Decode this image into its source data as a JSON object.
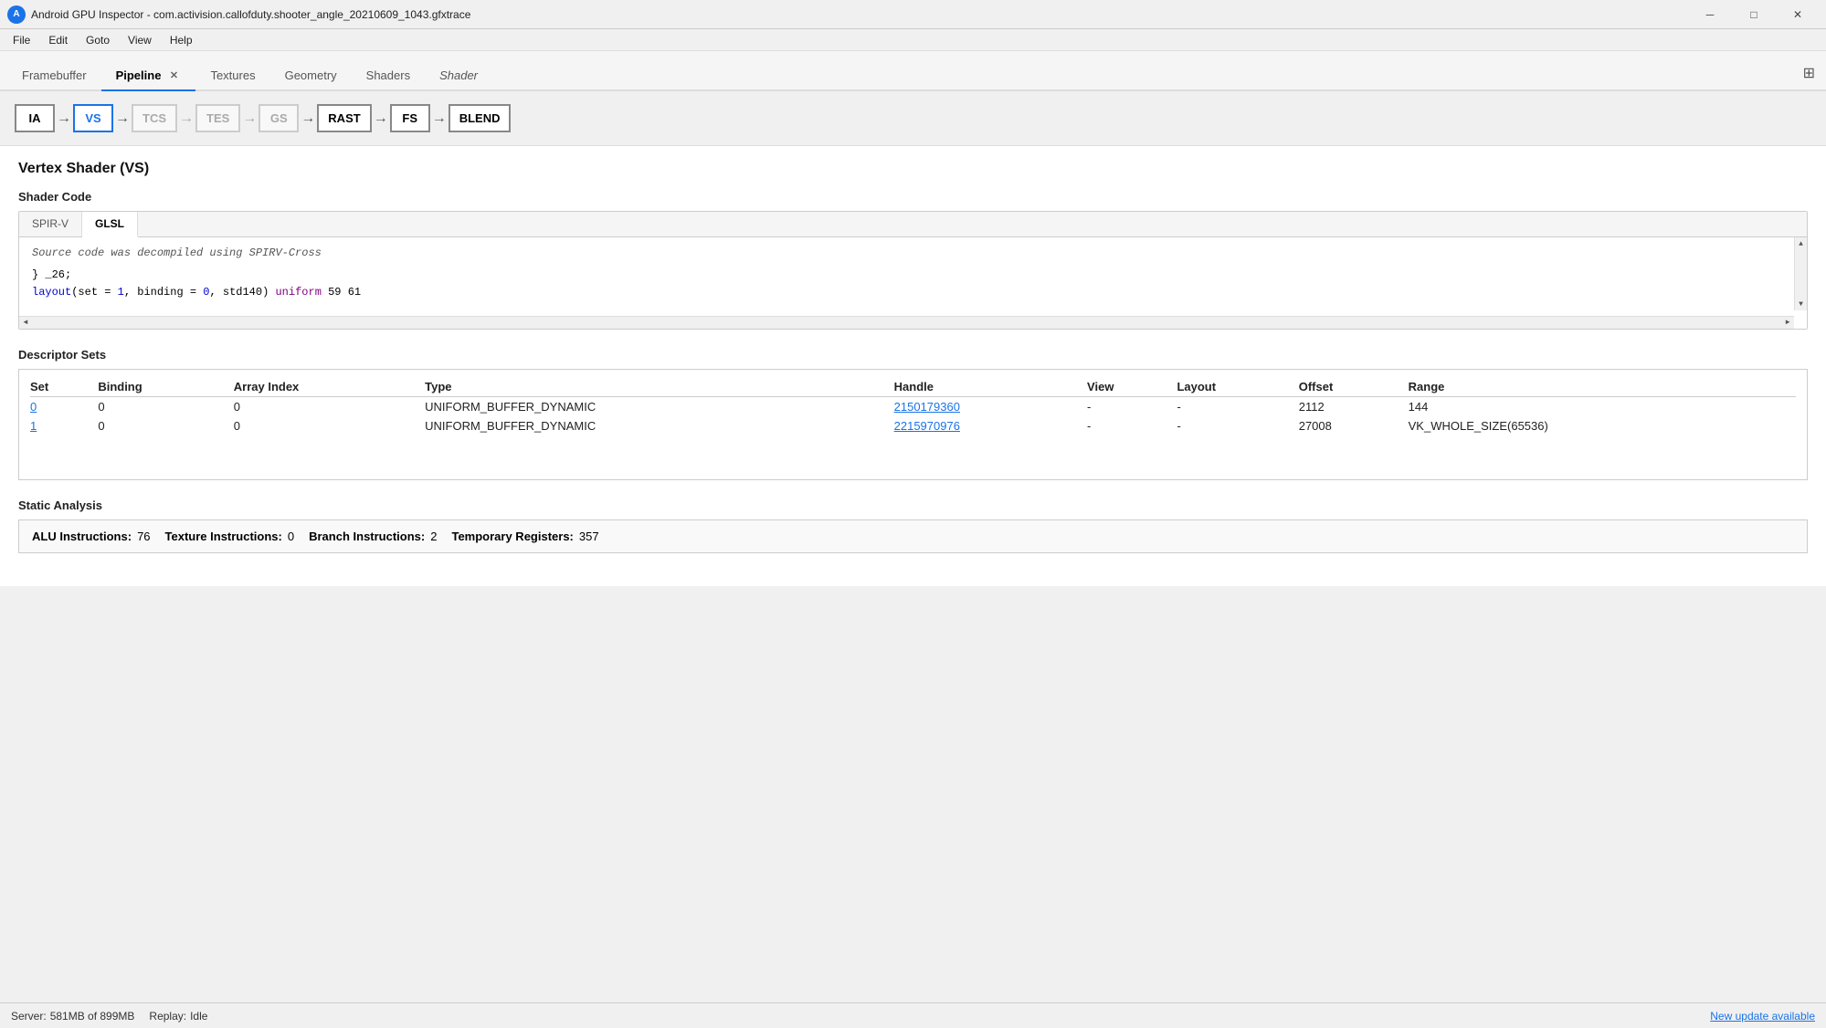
{
  "app": {
    "title": "Android GPU Inspector - com.activision.callofduty.shooter_angle_20210609_1043.gfxtrace",
    "icon": "🌐"
  },
  "titlebar_controls": {
    "minimize": "─",
    "maximize": "□",
    "close": "✕"
  },
  "menubar": {
    "items": [
      "File",
      "Edit",
      "Goto",
      "View",
      "Help"
    ]
  },
  "tabs": [
    {
      "id": "framebuffer",
      "label": "Framebuffer",
      "active": false,
      "closeable": false
    },
    {
      "id": "pipeline",
      "label": "Pipeline",
      "active": true,
      "closeable": true
    },
    {
      "id": "textures",
      "label": "Textures",
      "active": false,
      "closeable": false
    },
    {
      "id": "geometry",
      "label": "Geometry",
      "active": false,
      "closeable": false
    },
    {
      "id": "shaders",
      "label": "Shaders",
      "active": false,
      "closeable": false
    },
    {
      "id": "shader",
      "label": "Shader",
      "active": false,
      "closeable": false,
      "italic": true
    }
  ],
  "pipeline_stages": [
    {
      "id": "ia",
      "label": "IA",
      "active": false,
      "disabled": false
    },
    {
      "id": "vs",
      "label": "VS",
      "active": true,
      "disabled": false
    },
    {
      "id": "tcs",
      "label": "TCS",
      "active": false,
      "disabled": true
    },
    {
      "id": "tes",
      "label": "TES",
      "active": false,
      "disabled": true
    },
    {
      "id": "gs",
      "label": "GS",
      "active": false,
      "disabled": true
    },
    {
      "id": "rast",
      "label": "RAST",
      "active": false,
      "disabled": false
    },
    {
      "id": "fs",
      "label": "FS",
      "active": false,
      "disabled": false
    },
    {
      "id": "blend",
      "label": "BLEND",
      "active": false,
      "disabled": false
    }
  ],
  "section": {
    "title": "Vertex Shader (VS)"
  },
  "shader_code": {
    "title": "Shader Code",
    "tabs": [
      {
        "id": "spirv",
        "label": "SPIR-V",
        "active": false
      },
      {
        "id": "glsl",
        "label": "GLSL",
        "active": true
      }
    ],
    "note": "Source code was decompiled using SPIRV-Cross",
    "lines": [
      {
        "text": "} _26;"
      },
      {
        "text": "layout(set = 1, binding = 0, std140) uniform 59 61"
      }
    ]
  },
  "descriptor_sets": {
    "title": "Descriptor Sets",
    "columns": [
      "Set",
      "Binding",
      "Array Index",
      "Type",
      "Handle",
      "View",
      "Layout",
      "Offset",
      "Range"
    ],
    "rows": [
      {
        "set_link": "0",
        "binding": "0",
        "array_index": "0",
        "type": "UNIFORM_BUFFER_DYNAMIC",
        "handle": "2150179360",
        "view": "-",
        "layout": "-",
        "offset": "2112",
        "range": "144"
      },
      {
        "set_link": "1",
        "binding": "0",
        "array_index": "0",
        "type": "UNIFORM_BUFFER_DYNAMIC",
        "handle": "2215970976",
        "view": "-",
        "layout": "-",
        "offset": "27008",
        "range": "VK_WHOLE_SIZE(65536)"
      }
    ]
  },
  "static_analysis": {
    "title": "Static Analysis",
    "stats": [
      {
        "label": "ALU Instructions:",
        "value": "76"
      },
      {
        "label": "Texture Instructions:",
        "value": "0"
      },
      {
        "label": "Branch Instructions:",
        "value": "2"
      },
      {
        "label": "Temporary Registers:",
        "value": "357"
      }
    ]
  },
  "statusbar": {
    "server_label": "Server:",
    "server_memory": "581MB of 899MB",
    "replay_label": "Replay:",
    "replay_status": "Idle",
    "update_text": "New update available"
  }
}
